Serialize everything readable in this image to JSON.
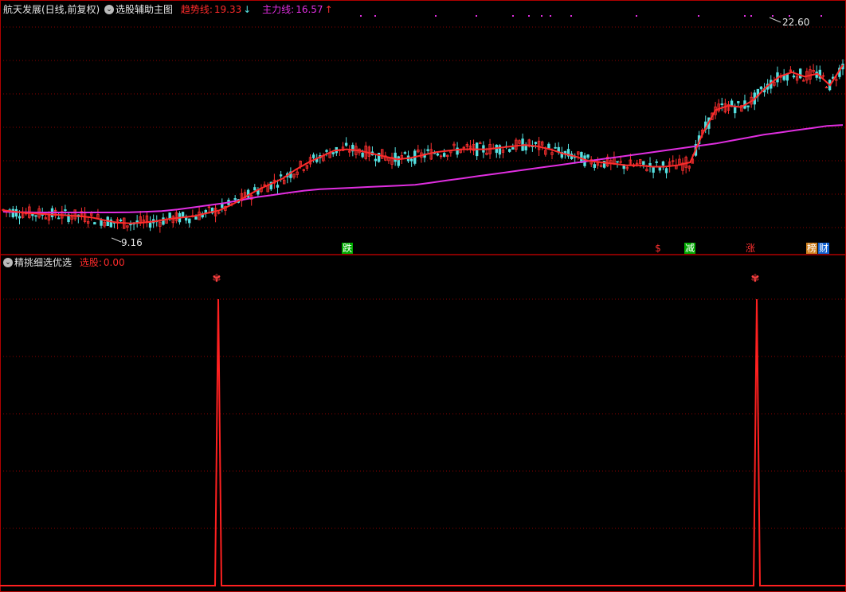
{
  "top_panel": {
    "stock_title": "航天发展(日线,前复权)",
    "indicator_name": "选股辅助主图",
    "trend_label": "趋势线:",
    "trend_value": "19.33",
    "trend_arrow": "↓",
    "main_label": "主力线:",
    "main_value": "16.57",
    "main_arrow": "↑",
    "expand_icon": "chevron-down-icon",
    "colors": {
      "trend": "#ff2b2b",
      "main": "#e02ee0",
      "up": "#ff3030",
      "down": "#55e0e0",
      "grid": "#8b0000"
    }
  },
  "bottom_panel": {
    "indicator_name": "精挑细选优选",
    "select_label": "选股:",
    "select_value": "0.00",
    "expand_icon": "chevron-down-icon",
    "signal_icon": "butterfly-icon"
  },
  "chart_data": [
    {
      "type": "candlestick",
      "panel": "main",
      "price_high_label": "22.60",
      "price_low_label": "9.16",
      "series": [
        {
          "name": "趋势线",
          "values": [
            10.7,
            10.6,
            10.5,
            10.45,
            10.4,
            10.35,
            10.3,
            10.2,
            10.0,
            9.85,
            9.8,
            9.85,
            9.95,
            10.1,
            10.2,
            10.3,
            10.5,
            10.7,
            11.1,
            11.6,
            12.1,
            12.5,
            12.9,
            13.5,
            14.0,
            14.4,
            14.8,
            14.9,
            14.8,
            14.6,
            14.4,
            14.2,
            14.3,
            14.5,
            14.7,
            14.8,
            14.9,
            14.9,
            14.9,
            15.0,
            15.1,
            15.2,
            15.1,
            14.9,
            14.6,
            14.4,
            14.1,
            14.0,
            13.9,
            13.8,
            13.8,
            13.7,
            13.7,
            13.8,
            14.0,
            16.0,
            17.6,
            17.9,
            17.8,
            18.3,
            19.2,
            19.9,
            20.2,
            19.9,
            20.1,
            19.3,
            20.7
          ]
        },
        {
          "name": "主力线",
          "values": [
            10.6,
            10.57,
            10.55,
            10.55,
            10.55,
            10.55,
            10.55,
            10.55,
            10.56,
            10.6,
            10.65,
            10.75,
            10.9,
            11.05,
            11.2,
            11.4,
            11.6,
            11.75,
            11.9,
            12.05,
            12.15,
            12.2,
            12.25,
            12.3,
            12.35,
            12.4,
            12.45,
            12.6,
            12.75,
            12.9,
            13.05,
            13.2,
            13.35,
            13.5,
            13.65,
            13.8,
            13.95,
            14.1,
            14.25,
            14.4,
            14.55,
            14.7,
            14.85,
            15.0,
            15.15,
            15.3,
            15.5,
            15.7,
            15.9,
            16.05,
            16.2,
            16.35,
            16.5,
            16.57
          ]
        }
      ],
      "markers": [
        "跌",
        "$",
        "减",
        "涨",
        "榜",
        "财"
      ]
    },
    {
      "type": "line",
      "panel": "sub",
      "series": [
        {
          "name": "选股",
          "values": [
            0,
            0,
            0,
            1,
            0,
            0,
            0,
            0,
            0,
            0,
            1,
            0,
            0
          ]
        }
      ]
    }
  ]
}
